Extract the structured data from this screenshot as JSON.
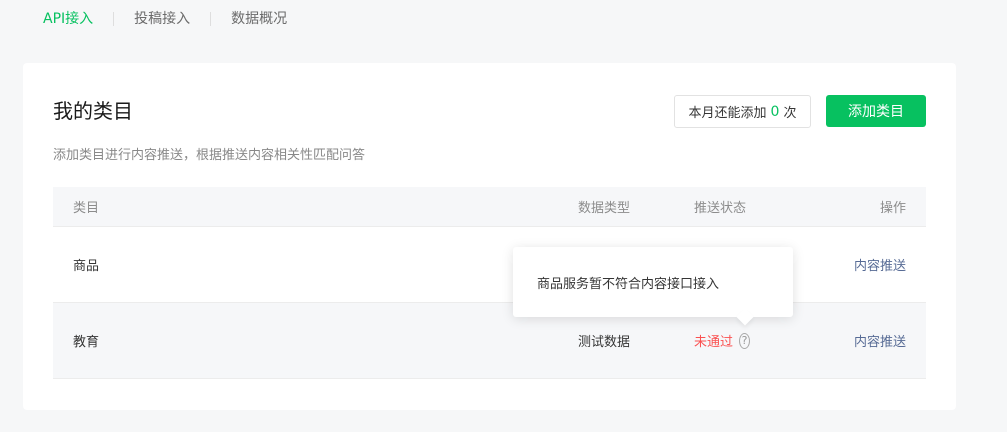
{
  "nav": {
    "tabs": [
      {
        "label": "API接入"
      },
      {
        "label": "投稿接入"
      },
      {
        "label": "数据概况"
      }
    ]
  },
  "card": {
    "title": "我的类目",
    "desc": "添加类目进行内容推送，根据推送内容相关性匹配问答",
    "quota_prefix": "本月还能添加",
    "quota_count": "0",
    "quota_suffix": "次",
    "add_button": "添加类目"
  },
  "table": {
    "headers": {
      "name": "类目",
      "type": "数据类型",
      "status": "推送状态",
      "action": "操作"
    },
    "rows": [
      {
        "name": "商品",
        "type": "",
        "status": "",
        "action": "内容推送"
      },
      {
        "name": "教育",
        "type": "测试数据",
        "status": "未通过",
        "action": "内容推送"
      }
    ]
  },
  "tooltip": {
    "text": "商品服务暂不符合内容接口接入"
  },
  "colors": {
    "brand": "#07c160",
    "danger": "#fa5151",
    "link": "#576b95"
  }
}
